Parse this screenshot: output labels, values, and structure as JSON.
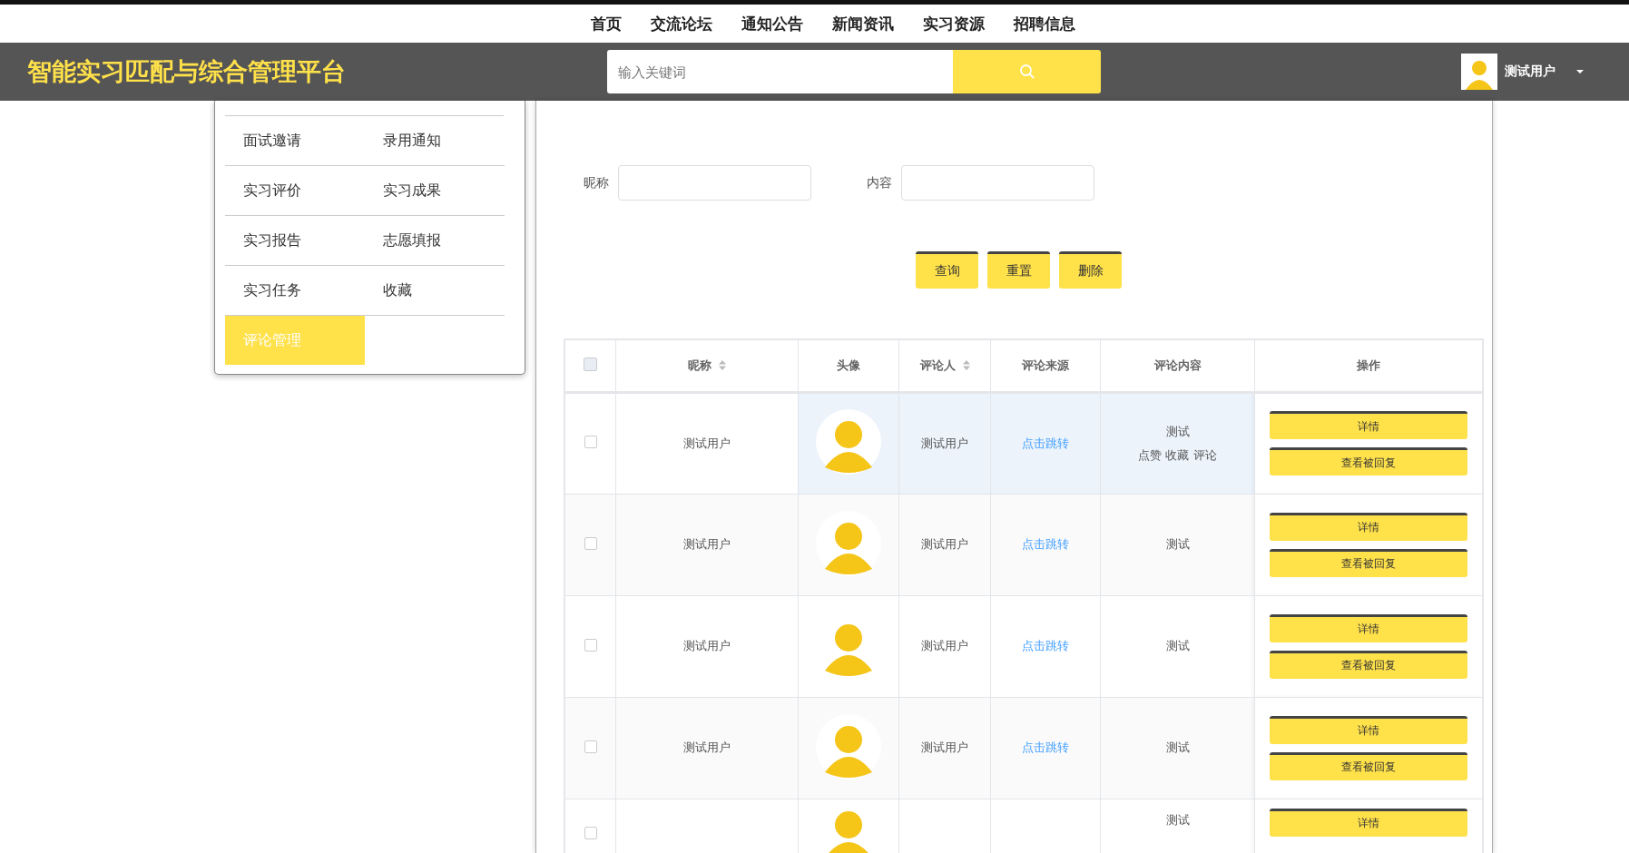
{
  "top_nav": [
    {
      "label": "首页"
    },
    {
      "label": "交流论坛"
    },
    {
      "label": "通知公告"
    },
    {
      "label": "新闻资讯"
    },
    {
      "label": "实习资源"
    },
    {
      "label": "招聘信息"
    }
  ],
  "header": {
    "title": "智能实习匹配与综合管理平台",
    "search": {
      "placeholder": "输入关键词"
    },
    "user": {
      "name": "测试用户"
    }
  },
  "side_menu": {
    "items": [
      {
        "label": "面试邀请",
        "selected": false
      },
      {
        "label": "录用通知",
        "selected": false
      },
      {
        "label": "实习评价",
        "selected": false
      },
      {
        "label": "实习成果",
        "selected": false
      },
      {
        "label": "实习报告",
        "selected": false
      },
      {
        "label": "志愿填报",
        "selected": false
      },
      {
        "label": "实习任务",
        "selected": false
      },
      {
        "label": "收藏",
        "selected": false
      },
      {
        "label": "评论管理",
        "selected": true
      }
    ]
  },
  "filters": [
    {
      "label": "昵称"
    },
    {
      "label": "内容"
    }
  ],
  "actions": [
    "查询",
    "重置",
    "删除"
  ],
  "table": {
    "select_all": {
      "checked": false
    },
    "columns": [
      {
        "kind": "checkbox"
      },
      {
        "kind": "text",
        "label": "昵称",
        "sortable": true
      },
      {
        "kind": "avatar",
        "label": "头像",
        "sortable": false
      },
      {
        "kind": "text",
        "label": "评论人",
        "sortable": true
      },
      {
        "kind": "link",
        "label": "评论来源",
        "sortable": false
      },
      {
        "kind": "content",
        "label": "评论内容",
        "sortable": false
      },
      {
        "kind": "actions",
        "label": "操作",
        "sortable": false
      }
    ],
    "rows": [
      {
        "checked": false,
        "highlighted": true,
        "nickname": "测试用户",
        "commenter": "测试用户",
        "source": "点击跳转",
        "content": [
          "测试",
          "点赞 收藏 评论"
        ],
        "buttons": [
          "详情",
          "查看被回复"
        ]
      },
      {
        "checked": false,
        "highlighted": false,
        "nickname": "测试用户",
        "commenter": "测试用户",
        "source": "点击跳转",
        "content": [
          "测试"
        ],
        "buttons": [
          "详情",
          "查看被回复"
        ]
      },
      {
        "checked": false,
        "highlighted": false,
        "nickname": "测试用户",
        "commenter": "测试用户",
        "source": "点击跳转",
        "content": [
          "测试"
        ],
        "buttons": [
          "详情",
          "查看被回复"
        ]
      },
      {
        "checked": false,
        "highlighted": false,
        "nickname": "测试用户",
        "commenter": "测试用户",
        "source": "点击跳转",
        "content": [
          "测试"
        ],
        "buttons": [
          "详情",
          "查看被回复"
        ]
      },
      {
        "checked": false,
        "highlighted": false,
        "content": [
          "测试"
        ],
        "buttons": [
          "详情"
        ]
      }
    ]
  }
}
